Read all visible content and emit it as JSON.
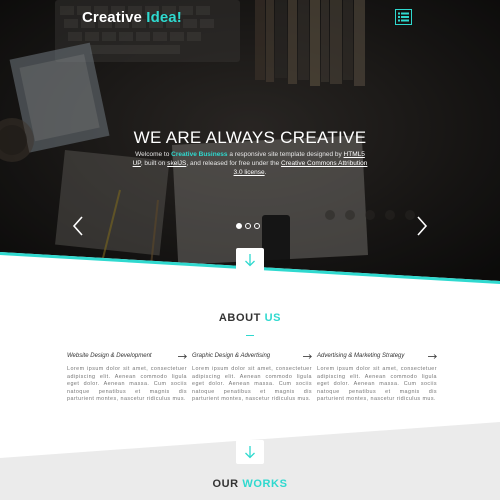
{
  "header": {
    "logo_main": "Creative",
    "logo_accent": "Idea!",
    "menu_icon": "hamburger-menu-icon"
  },
  "hero": {
    "title": "WE ARE ALWAYS CREATIVE",
    "text_1": "Welcome to ",
    "text_brand": "Creative Business",
    "text_2": " a responsive site template designed by ",
    "text_link_1": "HTML5 UP",
    "text_3": ", built on ",
    "text_link_2": "skelJS",
    "text_4": ", and released for free under the ",
    "text_link_3": "Creative Commons Attribution 3.0 license",
    "text_5": ".",
    "prev_icon": "chevron-left-icon",
    "next_icon": "chevron-right-icon",
    "slide_count": 3,
    "active_slide": 1,
    "background_image": "desk-workspace-photo"
  },
  "about": {
    "title_main": "ABOUT",
    "title_accent": "US",
    "columns": [
      {
        "heading": "Website Design & Development",
        "body": "Lorem ipsum dolor sit amet, consectetuer adipiscing elit. Aenean commodo ligula eget dolor. Aenean massa. Cum sociis natoque penatibus et magnis dis parturient montes, nascetur ridiculus mus."
      },
      {
        "heading": "Graphic Design & Advertising",
        "body": "Lorem ipsum dolor sit amet, consectetuer adipiscing elit. Aenean commodo ligula eget dolor. Aenean massa. Cum sociis natoque penatibus et magnis dis parturient montes, nascetur ridiculus mus."
      },
      {
        "heading": "Advertising & Marketing Strategy",
        "body": "Lorem ipsum dolor sit amet, consectetuer adipiscing elit. Aenean commodo ligula eget dolor. Aenean massa. Cum sociis natoque penatibus et magnis dis parturient montes, nascetur ridiculus mus."
      }
    ]
  },
  "works": {
    "title_main": "OUR",
    "title_accent": "WORKS"
  },
  "colors": {
    "accent": "#2fd9cf",
    "hero_dark": "#1c1a18",
    "text_dark": "#333333",
    "text_muted": "#777777",
    "works_bg": "#ebebeb"
  }
}
